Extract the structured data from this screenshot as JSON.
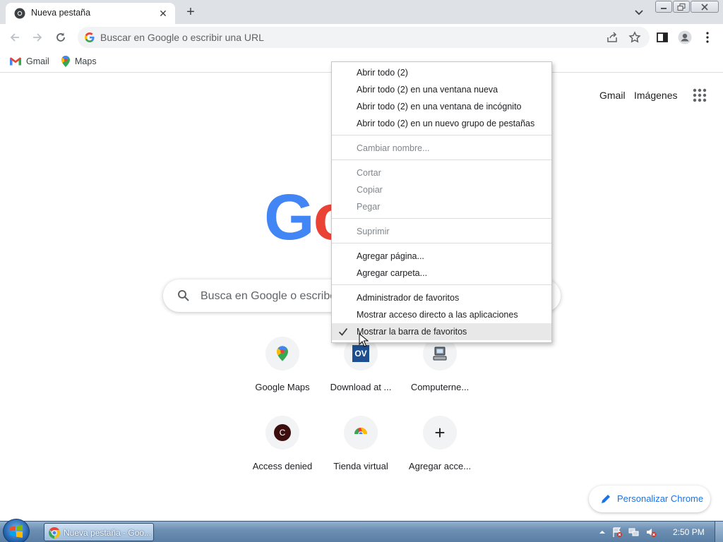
{
  "browser": {
    "tab": {
      "title": "Nueva pestaña",
      "favicon": "chrome-icon",
      "close": "✕"
    },
    "new_tab": "+",
    "omnibox": {
      "placeholder": "Buscar en Google o escribir una URL"
    },
    "bookmarks": [
      {
        "label": "Gmail",
        "icon": "gmail-icon"
      },
      {
        "label": "Maps",
        "icon": "maps-pin-icon"
      }
    ]
  },
  "ntp": {
    "links": {
      "gmail": "Gmail",
      "images": "Imágenes"
    },
    "logo": [
      "G",
      "o"
    ],
    "search_placeholder": "Busca en Google o escribe",
    "shortcuts": [
      {
        "label": "Google Maps",
        "icon": "maps-pin-icon"
      },
      {
        "label": "Download at ...",
        "icon": "ov-icon",
        "icon_text": "OV"
      },
      {
        "label": "Computerne...",
        "icon": "computer-icon"
      },
      {
        "label": "Access denied",
        "icon": "letter-c-icon",
        "icon_text": "C"
      },
      {
        "label": "Tienda virtual",
        "icon": "webstore-icon"
      },
      {
        "label": "Agregar acce...",
        "icon": "plus-icon",
        "icon_text": "+"
      }
    ],
    "customize": "Personalizar Chrome"
  },
  "context_menu": {
    "groups": [
      [
        {
          "label": "Abrir todo (2)",
          "enabled": true
        },
        {
          "label": "Abrir todo (2) en una ventana nueva",
          "enabled": true
        },
        {
          "label": "Abrir todo (2) en una ventana de incógnito",
          "enabled": true
        },
        {
          "label": "Abrir todo (2) en un nuevo grupo de pestañas",
          "enabled": true
        }
      ],
      [
        {
          "label": "Cambiar nombre...",
          "enabled": false
        }
      ],
      [
        {
          "label": "Cortar",
          "enabled": false
        },
        {
          "label": "Copiar",
          "enabled": false
        },
        {
          "label": "Pegar",
          "enabled": false
        }
      ],
      [
        {
          "label": "Suprimir",
          "enabled": false
        }
      ],
      [
        {
          "label": "Agregar página...",
          "enabled": true
        },
        {
          "label": "Agregar carpeta...",
          "enabled": true
        }
      ],
      [
        {
          "label": "Administrador de favoritos",
          "enabled": true
        },
        {
          "label": "Mostrar acceso directo a las aplicaciones",
          "enabled": true
        },
        {
          "label": "Mostrar la barra de favoritos",
          "enabled": true,
          "checked": true,
          "hovered": true
        }
      ]
    ]
  },
  "taskbar": {
    "task": "Nueva pestaña - Goo...",
    "clock": "2:50 PM"
  },
  "colors": {
    "google_blue": "#4285f4",
    "google_red": "#ea4335",
    "accent": "#1a73e8"
  }
}
